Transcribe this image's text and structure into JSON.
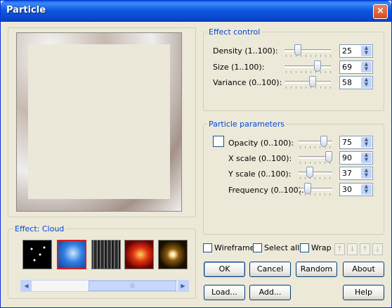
{
  "window": {
    "title": "Particle",
    "close_label": "×"
  },
  "effect_control": {
    "legend": "Effect control",
    "rows": [
      {
        "label": "Density (1..100):",
        "value": "25"
      },
      {
        "label": "Size (1..100):",
        "value": "69"
      },
      {
        "label": "Variance (0..100):",
        "value": "58"
      }
    ]
  },
  "particle_parameters": {
    "legend": "Particle parameters",
    "rows": [
      {
        "label": "Opacity (0..100):",
        "value": "75"
      },
      {
        "label": "X scale (0..100):",
        "value": "90"
      },
      {
        "label": "Y scale (0..100):",
        "value": "37"
      },
      {
        "label": "Frequency (0..100):",
        "value": "30"
      }
    ]
  },
  "effect": {
    "legend": "Effect: Cloud",
    "thumbnails": [
      "stars",
      "cloud",
      "rain",
      "fire",
      "flare"
    ],
    "selected": "cloud"
  },
  "options": {
    "wireframe": "Wireframe",
    "select_all": "Select all",
    "wrap": "Wrap"
  },
  "arrows": [
    "↑",
    "↓",
    "⤒",
    "⤓"
  ],
  "buttons": {
    "ok": "OK",
    "cancel": "Cancel",
    "random": "Random",
    "about": "About",
    "load": "Load...",
    "add": "Add...",
    "help": "Help"
  },
  "scrollbar": {
    "left": "◀",
    "right": "▶",
    "grip": "|||"
  },
  "spin_up": "▲",
  "spin_down": "▼"
}
